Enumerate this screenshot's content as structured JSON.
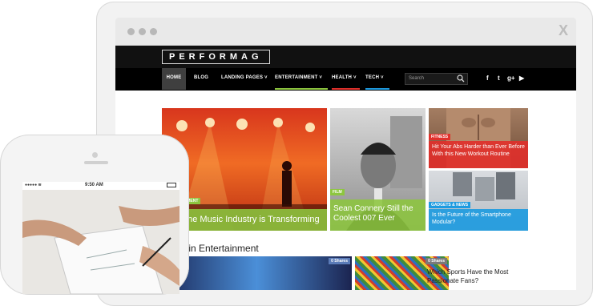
{
  "browser": {
    "close_label": "X"
  },
  "site": {
    "logo": "PERFORMAG",
    "nav": [
      {
        "label": "HOME",
        "color": "#3f3f3f"
      },
      {
        "label": "BLOG",
        "color": ""
      },
      {
        "label": "LANDING PAGES ˅",
        "color": ""
      },
      {
        "label": "ENTERTAINMENT ˅",
        "color": "#8dc63f"
      },
      {
        "label": "HEALTH ˅",
        "color": "#e0302b"
      },
      {
        "label": "TECH ˅",
        "color": "#1e9be0"
      }
    ],
    "search_placeholder": "Search",
    "social": [
      "f",
      "t",
      "g+",
      "▶"
    ]
  },
  "tiles": {
    "concert": {
      "tag": "ENTERTAINMENT",
      "caption": "How the Music Industry is Transforming",
      "tag_color": "#8dc63f"
    },
    "bond": {
      "tag": "FILM",
      "caption": "Sean Connery Still the Coolest 007 Ever",
      "tag_color": "#8dc63f"
    },
    "fitness": {
      "tag": "FITNESS",
      "caption": "Hit Your Abs Harder than Ever Before With this New Workout Routine",
      "tag_color": "#e0302b"
    },
    "phone": {
      "tag": "GADGETS & NEWS",
      "caption": "Is the Future of the Smartphone Modular?",
      "tag_color": "#1e9be0"
    }
  },
  "section": {
    "title": "Posts in Entertainment"
  },
  "cards": [
    {
      "shares": "0 Shares"
    },
    {
      "shares": "0 Shares",
      "title": "Which Sports Have the Most Passionate Fans?"
    }
  ],
  "phone": {
    "time": "9:50 AM"
  }
}
